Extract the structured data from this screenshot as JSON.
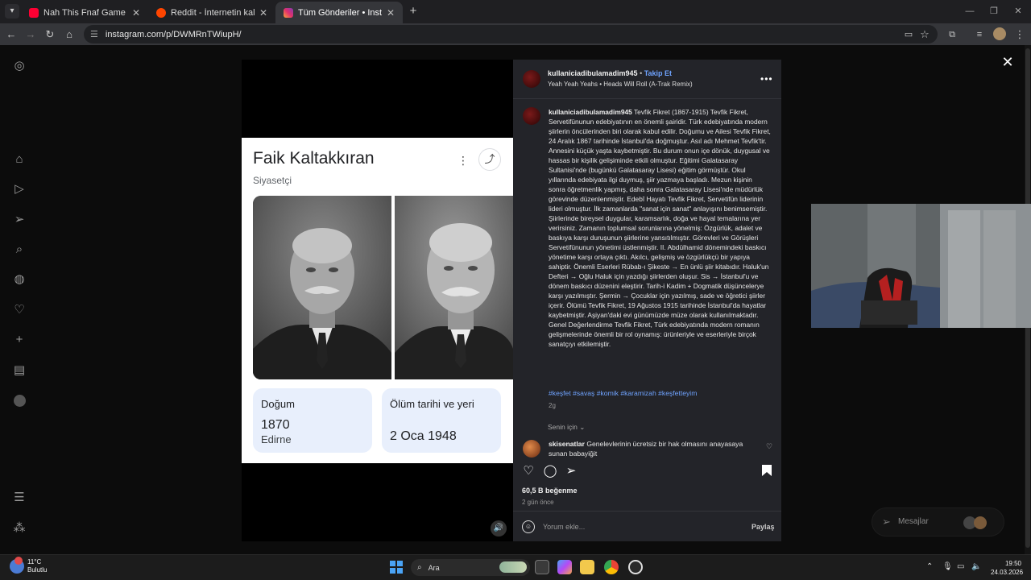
{
  "browser": {
    "tabs": [
      {
        "title": "Nah This Fnaf Game Is just STRA",
        "favicon_color": "#ff0033",
        "active": false
      },
      {
        "title": "Reddit - İnternetin kalbi",
        "favicon_color": "#ff4500",
        "active": false
      },
      {
        "title": "Tüm Gönderiler • Instagram",
        "favicon_color": "#e1306c",
        "active": true
      }
    ],
    "url": "instagram.com/p/DWMRnTWiupH/"
  },
  "media": {
    "card": {
      "name": "Faik Kaltakkıran",
      "subtitle": "Siyasetçi",
      "born_label": "Doğum",
      "born_year": "1870",
      "born_place": "Edirne",
      "death_label": "Ölüm tarihi ve yeri",
      "death_date": "2 Oca 1948"
    }
  },
  "post": {
    "username": "kullaniciadibulamadim945",
    "follow_label": "Takip Et",
    "song": "Yeah Yeah Yeahs • Heads Will Roll (A-Trak Remix)",
    "caption": "Tevfik Fikret (1867-1915) Tevfik Fikret, Servetifünunun edebiyatının en önemli şairidir. Türk edebiyatında modern şiirlerin öncülerinden biri olarak kabul edilir. Doğumu ve Ailesi Tevfik Fikret, 24 Aralık 1867 tarihinde İstanbul'da doğmuştur. Asıl adı Mehmet Tevfik'tir. Annesini küçük yaşta kaybetmiştir. Bu durum onun içe dönük, duygusal ve hassas bir kişilik gelişiminde etkili olmuştur. Eğitimi Galatasaray Sultanisi'nde (bugünkü Galatasaray Lisesi) eğitim görmüştür. Okul yıllarında edebiyata ilgi duymuş, şiir yazmaya başladı. Mezun kişinin sonra öğretmenlik yapmış, daha sonra Galatasaray Lisesi'nde müdürlük görevinde düzenlenmiştir. Edebî Hayatı Tevfik Fikret, Servetifün liderinin lideri olmuştur. İlk zamanlarda \"sanat için sanat\" anlayışını benimsemiştir. Şiirlerinde bireysel duygular, karamsarlık, doğa ve hayal temalarına yer verirsiniz. Zamanın toplumsal sorunlarına yönelmiş: Özgürlük, adalet ve baskıya karşı duruşunun şiirlerine yansıtılmıştır. Görevleri ve Görüşleri Servetifünunun yönetimi üstlenmiştir. II. Abdülhamid dönemindeki baskıcı yönetime karşı ortaya çıktı. Akılcı, gelişmiş ve özgürlükçü bir yapıya sahiptir. Önemli Eserleri Rübab-ı Şikeste → En ünlü şiir kitabıdır. Haluk'un Defteri → Oğlu Haluk için yazdığı şiirlerden oluşur. Sis → İstanbul'u ve dönem baskıcı düzenini eleştirir. Tarih-i Kadim + Dogmatik düşüncelerye karşı yazılmıştır. Şermin → Çocuklar için yazılmış, sade ve öğretici şiirler içerir. Ölümü Tevfik Fikret, 19 Ağustos 1915 tarihinde İstanbul'da hayatlar kaybetmiştir. Aşiyan'daki evi günümüzde müze olarak kullanılmaktadır. Genel Değerlendirme Tevfik Fikret, Türk edebiyatında modern romanın gelişmelerinde önemli bir rol oynamış: ürünleriyle ve eserleriyle birçok sanatçıyı etkilemiştir.",
    "hashtags": "#keşfet #savaş #komik #karamizah #keşfetteyim",
    "age": "2g",
    "for_you": "Senin için",
    "comment_user": "skisenatlar",
    "comment_text": "Genelevlerinin ücretsiz bir hak olmasını anayasaya sunan babayiğit",
    "likes": "60,5 B beğenme",
    "posted": "2 gün önce",
    "comment_placeholder": "Yorum ekle...",
    "post_label": "Paylaş"
  },
  "messages": {
    "label": "Mesajlar"
  },
  "taskbar": {
    "temp": "11°C",
    "weather": "Bulutlu",
    "search": "Ara",
    "time": "19:50",
    "date": "24.03.2026"
  }
}
